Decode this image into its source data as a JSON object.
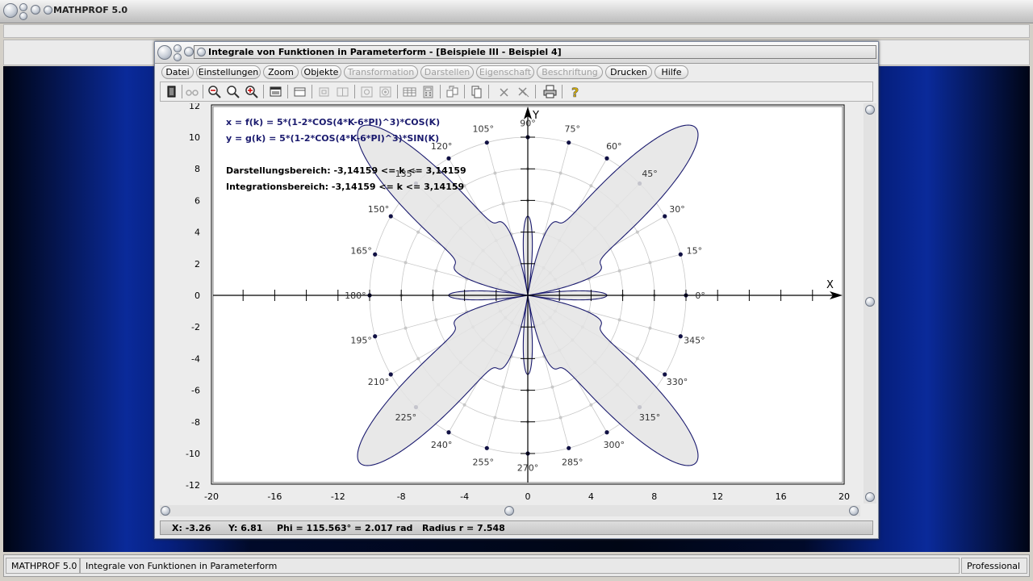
{
  "app": {
    "title": "MATHPROF 5.0"
  },
  "window": {
    "title": "Integrale von Funktionen in Parameterform - [Beispiele III - Beispiel 4]"
  },
  "menu": [
    {
      "label": "Datei",
      "enabled": true
    },
    {
      "label": "Einstellungen",
      "enabled": true
    },
    {
      "label": "Zoom",
      "enabled": true
    },
    {
      "label": "Objekte",
      "enabled": true
    },
    {
      "label": "Transformation",
      "enabled": false
    },
    {
      "label": "Darstellen",
      "enabled": false
    },
    {
      "label": "Eigenschaft",
      "enabled": false
    },
    {
      "label": "Beschriftung",
      "enabled": false
    },
    {
      "label": "Drucken",
      "enabled": true
    },
    {
      "label": "Hilfe",
      "enabled": true
    }
  ],
  "toolbar": [
    "exit-icon",
    "glasses-icon",
    "zoom-out-icon",
    "zoom-icon",
    "zoom-in-icon",
    "properties-icon",
    "window-icon",
    "grid-icon",
    "grid-fine-icon",
    "contour-icon",
    "target-icon",
    "table-icon",
    "calculator-icon",
    "export-icon",
    "copy-icon",
    "clear-icon",
    "clear-all-icon",
    "print-icon",
    "help-icon"
  ],
  "plot": {
    "formula_x": "x = f(k) = 5*(1-2*COS(4*K-6*PI)^3)*COS(K)",
    "formula_y": "y = g(k) = 5*(1-2*COS(4*K-6*PI)^3)*SIN(K)",
    "range_display": "Darstellungsbereich: -3,14159 <= k <= 3,14159",
    "range_integration": "Integrationsbereich: -3,14159 <= k <= 3,14159",
    "x_axis_label": "X",
    "y_axis_label": "Y",
    "x_ticks": [
      "-20",
      "-16",
      "-12",
      "-8",
      "-4",
      "0",
      "4",
      "8",
      "12",
      "16",
      "20"
    ],
    "y_ticks": [
      "12",
      "10",
      "8",
      "6",
      "4",
      "2",
      "0",
      "-2",
      "-4",
      "-6",
      "-8",
      "-10",
      "-12"
    ],
    "angle_labels": [
      "0°",
      "15°",
      "30°",
      "45°",
      "60°",
      "75°",
      "90°",
      "105°",
      "120°",
      "135°",
      "150°",
      "165°",
      "180°",
      "195°",
      "210°",
      "225°",
      "240°",
      "255°",
      "270°",
      "285°",
      "300°",
      "315°",
      "330°",
      "345°"
    ],
    "curve_color": "#1a1a6e",
    "fill_color": "#e4e4e4"
  },
  "coords": {
    "x": "X: -3.26",
    "y": "Y: 6.81",
    "phi": "Phi = 115.563° = 2.017 rad",
    "radius": "Radius r = 7.548"
  },
  "status": {
    "app": "MATHPROF 5.0",
    "module": "Integrale von Funktionen in Parameterform",
    "edition": "Professional"
  }
}
